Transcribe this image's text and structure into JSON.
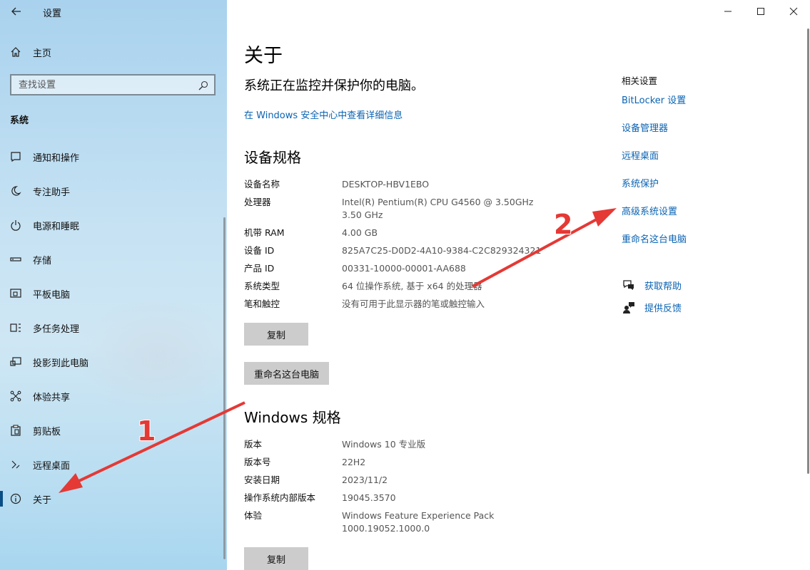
{
  "window": {
    "title": "设置",
    "controls": {
      "minimize": "minimize",
      "maximize": "maximize",
      "close": "close"
    }
  },
  "sidebar": {
    "home": "主页",
    "search_placeholder": "查找设置",
    "section": "系统",
    "items": [
      {
        "label": "通知和操作",
        "icon": "notification-icon"
      },
      {
        "label": "专注助手",
        "icon": "moon-icon"
      },
      {
        "label": "电源和睡眠",
        "icon": "power-icon"
      },
      {
        "label": "存储",
        "icon": "storage-icon"
      },
      {
        "label": "平板电脑",
        "icon": "tablet-icon"
      },
      {
        "label": "多任务处理",
        "icon": "multitask-icon"
      },
      {
        "label": "投影到此电脑",
        "icon": "project-icon"
      },
      {
        "label": "体验共享",
        "icon": "share-icon"
      },
      {
        "label": "剪贴板",
        "icon": "clipboard-icon"
      },
      {
        "label": "远程桌面",
        "icon": "remote-desktop-icon"
      },
      {
        "label": "关于",
        "icon": "info-icon",
        "active": true
      }
    ]
  },
  "main": {
    "title": "关于",
    "protection_status": "系统正在监控并保护你的电脑。",
    "security_link": "在 Windows 安全中心中查看详细信息",
    "device_specs": {
      "heading": "设备规格",
      "rows": [
        {
          "key": "设备名称",
          "value": "DESKTOP-HBV1EBO"
        },
        {
          "key": "处理器",
          "value": "Intel(R) Pentium(R) CPU G4560 @ 3.50GHz   3.50 GHz"
        },
        {
          "key": "机带 RAM",
          "value": "4.00 GB"
        },
        {
          "key": "设备 ID",
          "value": "825A7C25-D0D2-4A10-9384-C2C829324321"
        },
        {
          "key": "产品 ID",
          "value": "00331-10000-00001-AA688"
        },
        {
          "key": "系统类型",
          "value": "64 位操作系统, 基于 x64 的处理器"
        },
        {
          "key": "笔和触控",
          "value": "没有可用于此显示器的笔或触控输入"
        }
      ],
      "copy_button": "复制",
      "rename_button": "重命名这台电脑"
    },
    "windows_specs": {
      "heading": "Windows 规格",
      "rows": [
        {
          "key": "版本",
          "value": "Windows 10 专业版"
        },
        {
          "key": "版本号",
          "value": "22H2"
        },
        {
          "key": "安装日期",
          "value": "2023/11/2"
        },
        {
          "key": "操作系统内部版本",
          "value": "19045.3570"
        },
        {
          "key": "体验",
          "value": "Windows Feature Experience Pack 1000.19052.1000.0"
        }
      ],
      "copy_button": "复制"
    }
  },
  "related": {
    "title": "相关设置",
    "links": [
      "BitLocker 设置",
      "设备管理器",
      "远程桌面",
      "系统保护",
      "高级系统设置",
      "重命名这台电脑"
    ],
    "help": "获取帮助",
    "feedback": "提供反馈"
  },
  "annotations": {
    "marker_1": "1",
    "marker_2": "2",
    "arrow_color": "#e53935"
  }
}
